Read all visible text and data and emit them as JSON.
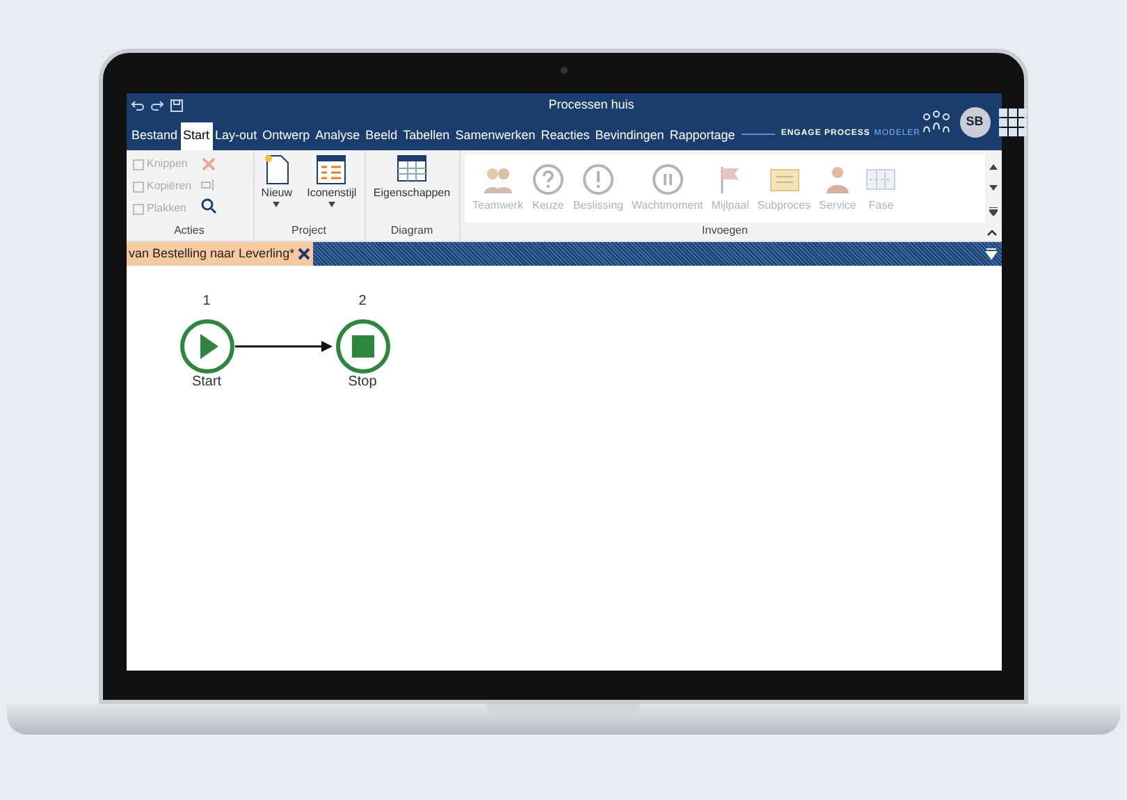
{
  "window": {
    "title": "Processen huis",
    "avatar": "SB"
  },
  "tabs": [
    {
      "label": "Bestand",
      "selected": false
    },
    {
      "label": "Start",
      "selected": true
    },
    {
      "label": "Lay-out",
      "selected": false
    },
    {
      "label": "Ontwerp",
      "selected": false
    },
    {
      "label": "Analyse",
      "selected": false
    },
    {
      "label": "Beeld",
      "selected": false
    },
    {
      "label": "Tabellen",
      "selected": false
    },
    {
      "label": "Samenwerken",
      "selected": false
    },
    {
      "label": "Reacties",
      "selected": false
    },
    {
      "label": "Bevindingen",
      "selected": false
    },
    {
      "label": "Rapportage",
      "selected": false
    }
  ],
  "brand": {
    "name": "ENGAGE PROCESS",
    "product": "MODELER"
  },
  "ribbon": {
    "acties": {
      "label": "Acties",
      "items": [
        {
          "label": "Knippen",
          "disabled": true
        },
        {
          "label": "Kopiëren",
          "disabled": true
        },
        {
          "label": "Plakken",
          "disabled": true
        }
      ]
    },
    "project": {
      "label": "Project",
      "items": [
        {
          "label": "Nieuw"
        },
        {
          "label": "Iconenstijl"
        }
      ]
    },
    "diagram": {
      "label": "Diagram",
      "items": [
        {
          "label": "Eigenschappen"
        }
      ]
    },
    "invoegen": {
      "label": "Invoegen",
      "items": [
        {
          "label": "Teamwerk",
          "kind": "team",
          "disabled": true
        },
        {
          "label": "Keuze",
          "kind": "question",
          "disabled": true
        },
        {
          "label": "Beslissing",
          "kind": "exclaim",
          "disabled": true
        },
        {
          "label": "Wachtmoment",
          "kind": "pause",
          "disabled": true
        },
        {
          "label": "Mijlpaal",
          "kind": "flag",
          "disabled": true
        },
        {
          "label": "Subproces",
          "kind": "sub",
          "disabled": true
        },
        {
          "label": "Service",
          "kind": "person",
          "disabled": true
        },
        {
          "label": "Fase",
          "kind": "phase",
          "disabled": true
        }
      ]
    }
  },
  "document_tab": {
    "label": "van Bestelling naar Leverling*",
    "selected": true
  },
  "diagram": {
    "nodes": [
      {
        "number": "1",
        "label": "Start",
        "kind": "start"
      },
      {
        "number": "2",
        "label": "Stop",
        "kind": "stop"
      }
    ]
  }
}
